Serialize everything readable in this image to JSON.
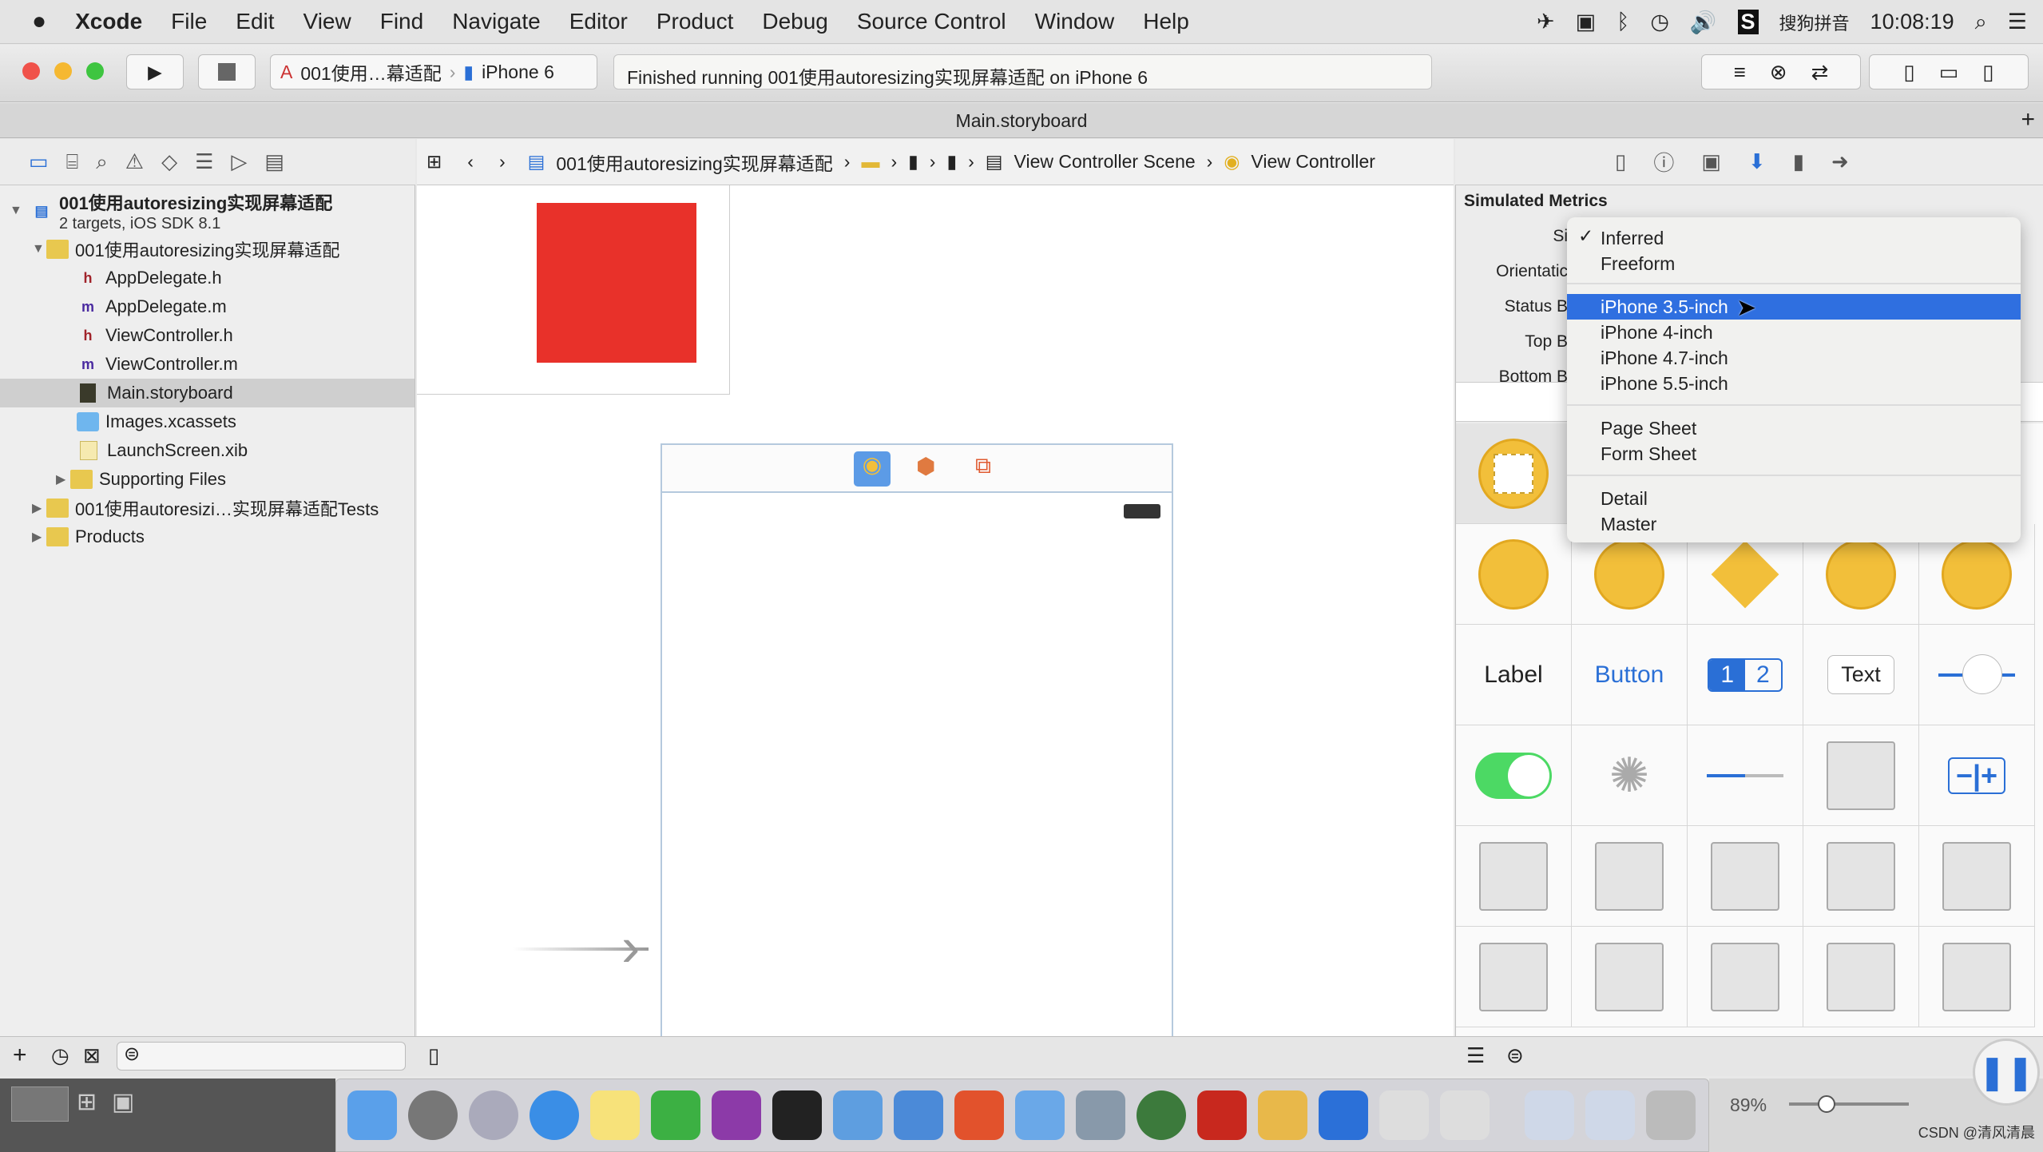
{
  "menubar": {
    "app": "Xcode",
    "items": [
      "File",
      "Edit",
      "View",
      "Find",
      "Navigate",
      "Editor",
      "Product",
      "Debug",
      "Source Control",
      "Window",
      "Help"
    ],
    "input_method": "搜狗拼音",
    "clock": "10:08:19"
  },
  "toolbar": {
    "scheme": "001使用…幕适配",
    "device": "iPhone 6",
    "status": "Finished running 001使用autoresizing实现屏幕适配 on iPhone 6"
  },
  "tab": {
    "title": "Main.storyboard"
  },
  "jumpbar": {
    "project": "001使用autoresizing实现屏幕适配",
    "scene": "View Controller Scene",
    "controller": "View Controller"
  },
  "navigator": {
    "project": {
      "name": "001使用autoresizing实现屏幕适配",
      "subtitle": "2 targets, iOS SDK 8.1"
    },
    "group": "001使用autoresizing实现屏幕适配",
    "files": [
      {
        "name": "AppDelegate.h",
        "kind": "h"
      },
      {
        "name": "AppDelegate.m",
        "kind": "m"
      },
      {
        "name": "ViewController.h",
        "kind": "h"
      },
      {
        "name": "ViewController.m",
        "kind": "m"
      },
      {
        "name": "Main.storyboard",
        "kind": "storyboard",
        "selected": true
      },
      {
        "name": "Images.xcassets",
        "kind": "assets"
      },
      {
        "name": "LaunchScreen.xib",
        "kind": "xib"
      }
    ],
    "supporting": "Supporting Files",
    "tests": "001使用autoresizi…实现屏幕适配Tests",
    "products": "Products"
  },
  "inspector": {
    "section": "Simulated Metrics",
    "labels": [
      "Si",
      "Orientatic",
      "Status B",
      "Top B",
      "Bottom B"
    ]
  },
  "size_menu": {
    "items": [
      "Inferred",
      "Freeform",
      "iPhone 3.5-inch",
      "iPhone 4-inch",
      "iPhone 4.7-inch",
      "iPhone 5.5-inch",
      "Page Sheet",
      "Form Sheet",
      "Detail",
      "Master"
    ],
    "checked": "Inferred",
    "highlighted": "iPhone 3.5-inch"
  },
  "library": {
    "label": "Label",
    "button": "Button",
    "seg1": "1",
    "seg2": "2",
    "text": "Text"
  },
  "zoom": "89%",
  "watermark": "CSDN @清风清晨",
  "colors": {
    "accent": "#2f6fe0",
    "red_view": "#e8312a",
    "object_yellow": "#f2bf3a"
  }
}
